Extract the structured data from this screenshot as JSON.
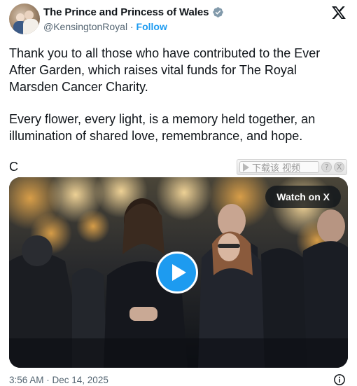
{
  "author": {
    "display_name": "The Prince and Princess of Wales",
    "handle": "@KensingtonRoyal",
    "separator": "·",
    "follow_label": "Follow",
    "verified_icon": "verified-badge-icon",
    "verified_color": "#829aab"
  },
  "tweet": {
    "paragraph_1": "Thank you to all those who have contributed to the Ever After Garden, which raises vital funds for The Royal Marsden Cancer Charity.",
    "paragraph_2": "Every flower, every light, is a memory held together, an illumination of shared love, remembrance, and hope.",
    "paragraph_3": "C"
  },
  "download_bar": {
    "label": "下载该 视频",
    "help_label": "?",
    "close_label": "X"
  },
  "media": {
    "watch_label": "Watch on X",
    "play_icon": "play-icon",
    "accent_color": "#1d9bf0"
  },
  "footer": {
    "timestamp": "3:56 AM · Dec 14, 2025",
    "info_icon": "info-icon"
  }
}
